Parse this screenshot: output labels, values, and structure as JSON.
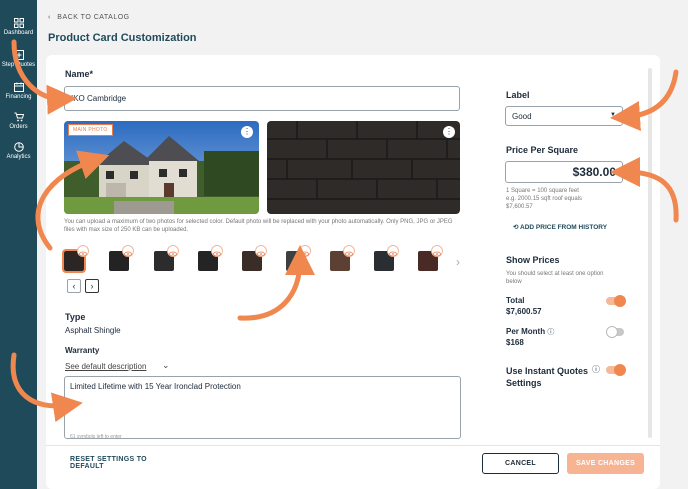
{
  "nav": [
    {
      "label": "Dashboard",
      "icon": "grid-icon"
    },
    {
      "label": "Step Quotes",
      "icon": "plus-square-icon"
    },
    {
      "label": "Financing",
      "icon": "calendar-icon"
    },
    {
      "label": "Orders",
      "icon": "cart-icon"
    },
    {
      "label": "Analytics",
      "icon": "chart-icon"
    }
  ],
  "header": {
    "back": "BACK TO CATALOG",
    "title": "Product Card Customization"
  },
  "form": {
    "name_label": "Name*",
    "name_value": "IKO Cambridge",
    "main_photo_badge": "MAIN PHOTO",
    "photo_hint": "You can upload a maximum of two photos for selected color. Default photo will be replaced with your photo automatically. Only PNG, JPG or JPEG files with max size of 250 KB can be uploaded.",
    "type_label": "Type",
    "type_value": "Asphalt Shingle",
    "warranty_label": "Warranty",
    "warranty_link": "See default description",
    "warranty_value": "Limited Lifetime with 15 Year Ironclad Protection",
    "warranty_counter": "61 symbols left to enter"
  },
  "side": {
    "label_label": "Label",
    "label_value": "Good",
    "price_label": "Price Per Square",
    "price_value": "$380.00",
    "price_hint_1": "1 Square = 100 square feet",
    "price_hint_2": "e.g. 2000.15 sqft roof equals",
    "price_hint_3": "$7,600.57",
    "add_price": "ADD PRICE FROM HISTORY",
    "show_prices_label": "Show Prices",
    "show_prices_hint": "You should select at least one option below",
    "total_label": "Total",
    "total_value": "$7,600.57",
    "per_month_label": "Per Month",
    "per_month_value": "$168",
    "instant_label": "Use Instant Quotes Settings"
  },
  "footer": {
    "reset": "RESET SETTINGS TO DEFAULT",
    "cancel": "CANCEL",
    "save": "SAVE CHANGES"
  },
  "colors": {
    "accent": "#f0874f",
    "sidebar": "#1f4a5a",
    "swatches": [
      "#2b2624",
      "#232323",
      "#2c2c2c",
      "#242425",
      "#3a2d28",
      "#3d4040",
      "#5b4033",
      "#2a2e33",
      "#4a2a24"
    ]
  }
}
